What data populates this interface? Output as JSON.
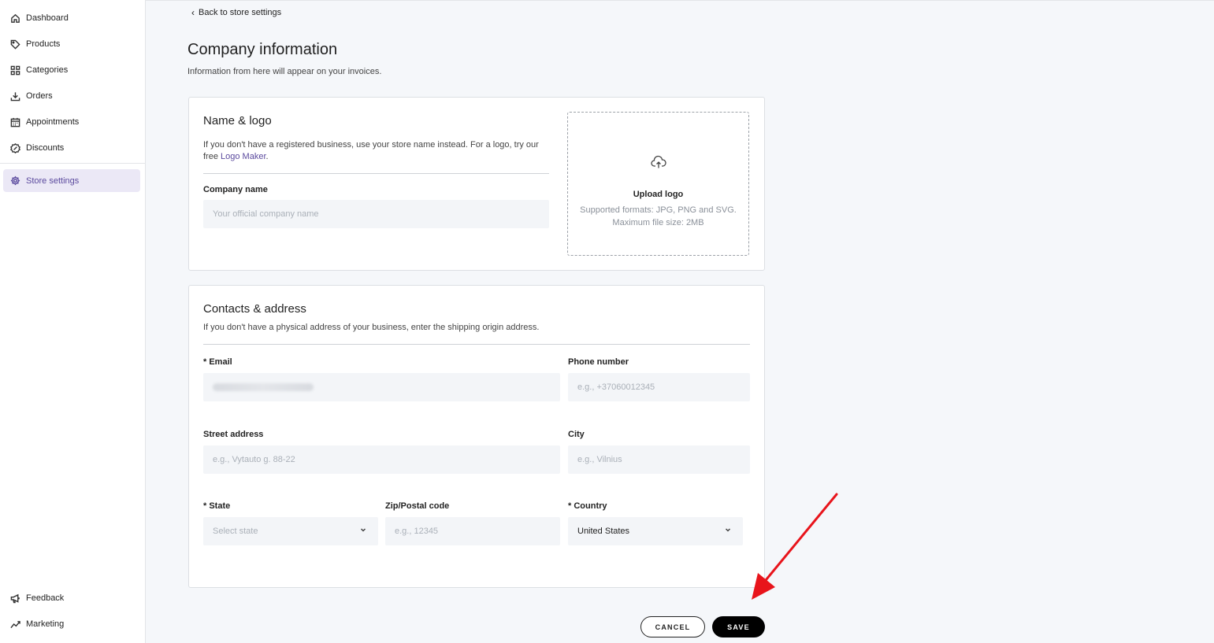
{
  "sidebar": {
    "items": [
      {
        "label": "Dashboard",
        "icon": "home-icon"
      },
      {
        "label": "Products",
        "icon": "tag-icon"
      },
      {
        "label": "Categories",
        "icon": "grid-icon"
      },
      {
        "label": "Orders",
        "icon": "download-icon"
      },
      {
        "label": "Appointments",
        "icon": "calendar-icon"
      },
      {
        "label": "Discounts",
        "icon": "badge-percent-icon"
      },
      {
        "label": "Store settings",
        "icon": "gear-icon",
        "active": true
      }
    ],
    "bottom_items": [
      {
        "label": "Feedback",
        "icon": "megaphone-icon"
      },
      {
        "label": "Marketing",
        "icon": "trend-icon"
      }
    ],
    "accent_color": "#5b4a9e"
  },
  "header": {
    "back_label": "Back to store settings",
    "title": "Company information",
    "subtitle": "Information from here will appear on your invoices."
  },
  "name_logo": {
    "title": "Name & logo",
    "desc_prefix": "If you don't have a registered business, use your store name instead. For a logo, try our free ",
    "desc_link": "Logo Maker",
    "desc_suffix": ".",
    "company_name_label": "Company name",
    "company_name_placeholder": "Your official company name",
    "upload_title": "Upload logo",
    "upload_formats": "Supported formats: JPG, PNG and SVG.",
    "upload_size": "Maximum file size: 2MB"
  },
  "contacts": {
    "title": "Contacts & address",
    "desc": "If you don't have a physical address of your business, enter the shipping origin address.",
    "email_label": "* Email",
    "phone_label": "Phone number",
    "phone_placeholder": "e.g., +37060012345",
    "street_label": "Street address",
    "street_placeholder": "e.g., Vytauto g. 88-22",
    "city_label": "City",
    "city_placeholder": "e.g., Vilnius",
    "state_label": "* State",
    "state_placeholder": "Select state",
    "zip_label": "Zip/Postal code",
    "zip_placeholder": "e.g., 12345",
    "country_label": "* Country",
    "country_value": "United States"
  },
  "actions": {
    "cancel_label": "CANCEL",
    "save_label": "SAVE"
  }
}
